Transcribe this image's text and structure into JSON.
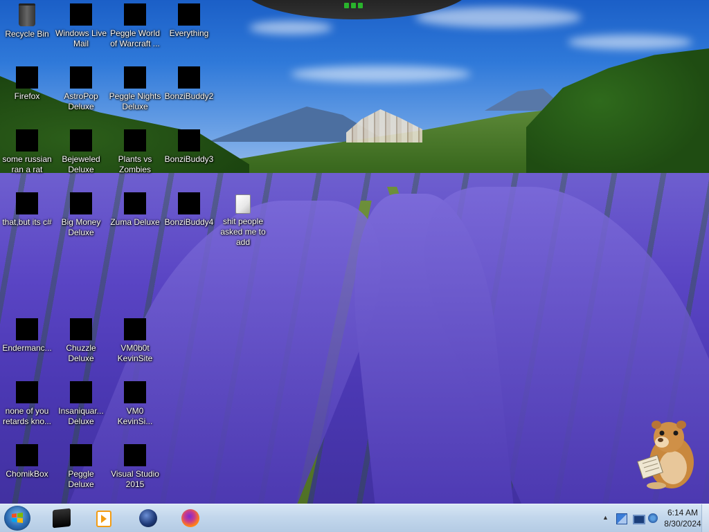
{
  "desktop": {
    "icons": [
      {
        "label": "Recycle Bin",
        "kind": "recycle"
      },
      {
        "label": "Windows Live Mail",
        "kind": "black"
      },
      {
        "label": "Peggle World of Warcraft ...",
        "kind": "black"
      },
      {
        "label": "Everything",
        "kind": "black"
      },
      {
        "label": "Firefox",
        "kind": "black"
      },
      {
        "label": "AstroPop Deluxe",
        "kind": "black"
      },
      {
        "label": "Peggle Nights Deluxe",
        "kind": "black"
      },
      {
        "label": "BonziBuddy2",
        "kind": "black"
      },
      {
        "label": "some russian ran a rat",
        "kind": "black"
      },
      {
        "label": "Bejeweled Deluxe",
        "kind": "black"
      },
      {
        "label": "Plants vs Zombies",
        "kind": "black"
      },
      {
        "label": "BonziBuddy3",
        "kind": "black"
      },
      {
        "label": "that,but its c#",
        "kind": "black"
      },
      {
        "label": "Big Money Deluxe",
        "kind": "black"
      },
      {
        "label": "Zuma Deluxe",
        "kind": "black"
      },
      {
        "label": "BonziBuddy4",
        "kind": "black"
      },
      {
        "label": "shit people asked me to add",
        "kind": "file"
      },
      {
        "label": "Endermanc...",
        "kind": "black"
      },
      {
        "label": "Chuzzle Deluxe",
        "kind": "black"
      },
      {
        "label": "VM0b0t KevinSite",
        "kind": "black"
      },
      {
        "label": "none of you retards kno...",
        "kind": "black"
      },
      {
        "label": "Insaniquar... Deluxe",
        "kind": "black"
      },
      {
        "label": "VM0 KevinSi...",
        "kind": "black"
      },
      {
        "label": "ChomikBox",
        "kind": "black"
      },
      {
        "label": "Peggle Deluxe",
        "kind": "black"
      },
      {
        "label": "Visual Studio 2015",
        "kind": "black"
      }
    ]
  },
  "gadget": {
    "name": "top-gadget"
  },
  "taskbar": {
    "start_icon": "windows-start-orb",
    "pinned": [
      {
        "name": "black-app-icon"
      },
      {
        "name": "media-player-icon"
      },
      {
        "name": "globe-icon"
      },
      {
        "name": "firefox-icon"
      }
    ],
    "tray": {
      "overflow_arrow": "▲",
      "time": "6:14 AM",
      "date": "8/30/2024"
    }
  },
  "colors": {
    "taskbar_bg": "#c3d7ec",
    "icon_label": "#ffffff",
    "gadget_led": "#29b32c"
  }
}
